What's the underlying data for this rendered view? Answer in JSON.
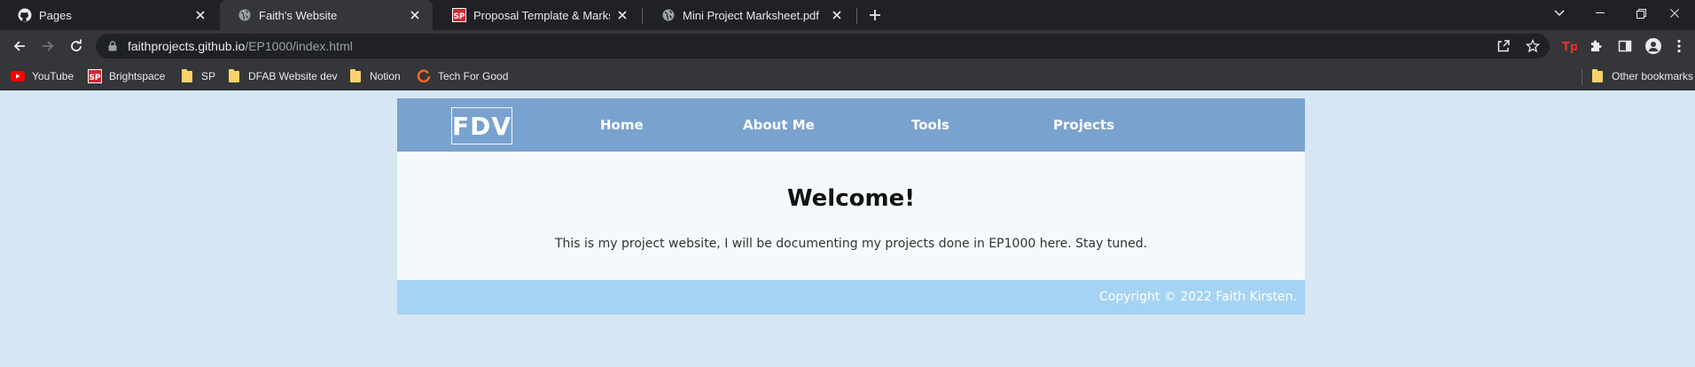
{
  "tabs": [
    {
      "title": "Pages",
      "icon": "github-icon",
      "active": false
    },
    {
      "title": "Faith's Website",
      "icon": "globe-icon",
      "active": true
    },
    {
      "title": "Proposal Template & Marksheet",
      "icon": "sp-icon",
      "active": false
    },
    {
      "title": "Mini Project Marksheet.pdf",
      "icon": "globe-icon",
      "active": false
    }
  ],
  "address_bar": {
    "host": "faithprojects.github.io",
    "path": "/EP1000/index.html"
  },
  "bookmarks": [
    {
      "label": "YouTube",
      "icon": "youtube-icon"
    },
    {
      "label": "Brightspace",
      "icon": "sp-icon"
    },
    {
      "label": "SP",
      "icon": "folder-icon"
    },
    {
      "label": "DFAB Website dev",
      "icon": "folder-icon"
    },
    {
      "label": "Notion",
      "icon": "folder-icon"
    },
    {
      "label": "Tech For Good",
      "icon": "tfg-icon"
    }
  ],
  "other_bookmarks": "Other bookmarks",
  "site": {
    "logo": "FDV",
    "nav": [
      "Home",
      "About Me",
      "Tools",
      "Projects"
    ],
    "heading": "Welcome!",
    "intro": "This is my project website, I will be documenting my projects done in EP1000 here. Stay tuned.",
    "footer": "Copyright © 2022 Faith Kirsten."
  },
  "colors": {
    "page_bg": "#d6e6f3",
    "nav_bg": "#7aa2cf",
    "main_bg": "#f4f9fb",
    "footer_bg": "#a5d3f3",
    "chrome_dark": "#202124",
    "chrome_toolbar": "#35363a"
  }
}
